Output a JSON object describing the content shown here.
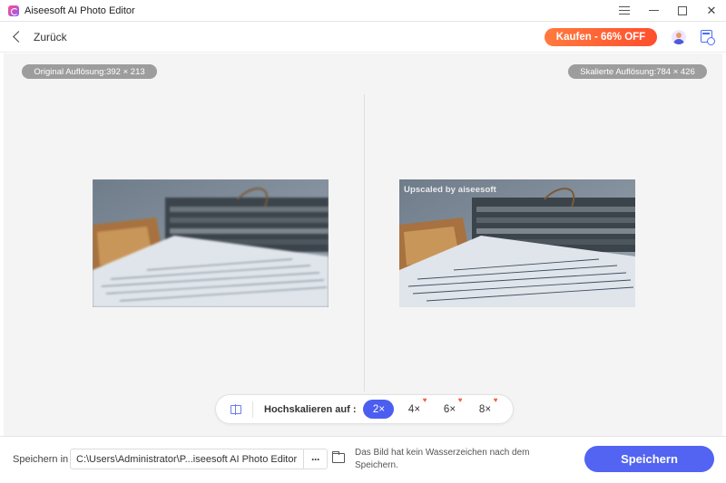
{
  "window": {
    "title": "Aiseesoft AI Photo Editor"
  },
  "header": {
    "back_label": "Zurück",
    "buy_label": "Kaufen - 66% OFF"
  },
  "preview": {
    "original_label": "Original Auflösung:392 × 213",
    "scaled_label": "Skalierte Auflösung:784 × 426",
    "watermark": "Upscaled by aiseesoft"
  },
  "upscale": {
    "label": "Hochskalieren auf :",
    "options": [
      {
        "label": "2×",
        "selected": true,
        "premium": false
      },
      {
        "label": "4×",
        "selected": false,
        "premium": true
      },
      {
        "label": "6×",
        "selected": false,
        "premium": true
      },
      {
        "label": "8×",
        "selected": false,
        "premium": true
      }
    ]
  },
  "footer": {
    "save_in_label": "Speichern in",
    "path_value": "C:\\Users\\Administrator\\P...iseesoft AI Photo Editor",
    "more_label": "···",
    "note": "Das Bild hat kein Wasserzeichen nach dem Speichern.",
    "save_label": "Speichern"
  },
  "colors": {
    "accent": "#5264f1",
    "buy": "#ff5a32",
    "pill": "#9d9d9d"
  }
}
